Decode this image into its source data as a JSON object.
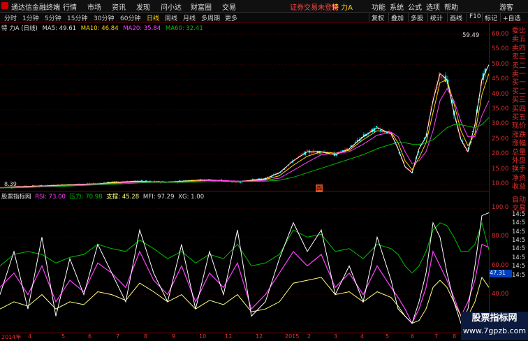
{
  "menu": {
    "app_title": "通达信金融终端",
    "items": [
      "行情",
      "市场",
      "资讯",
      "发现",
      "问小达",
      "财富圈",
      "交易"
    ],
    "status": "证券交易未登录",
    "stock": "特 力A",
    "right_items": [
      "功能",
      "系统",
      "公式",
      "选项",
      "帮助"
    ],
    "guest": "游客"
  },
  "period_bar": {
    "periods": [
      "分时",
      "1分钟",
      "5分钟",
      "15分钟",
      "30分钟",
      "60分钟",
      "日线",
      "周线",
      "月线",
      "多周期",
      "更多"
    ],
    "active": "日线",
    "tools": [
      "复权",
      "叠加",
      "多股",
      "统计",
      "画线",
      "F10",
      "标记",
      "+自选"
    ]
  },
  "main_legend": {
    "title": "特 力A (日线)",
    "ma5": "MA5: 49.61",
    "ma10": "MA10: 46.84",
    "ma20": "MA20: 35.84",
    "ma60": "MA60: 32.41",
    "high_label": "59.49",
    "low_label": "8.39",
    "event_mark": "四"
  },
  "lower_legend": {
    "title": "股票指标网",
    "rsi": "RSI: 73.00",
    "pressure": "压力: 70.98",
    "support": "支撑: 45.28",
    "mfi": "MFI: 97.29",
    "xg": "XG: 1.00",
    "current_value": "47.31"
  },
  "axis": {
    "price_ticks": [
      "60.00",
      "55.00",
      "50.00",
      "45.00",
      "40.00",
      "35.00",
      "30.00",
      "25.00",
      "20.00",
      "15.00",
      "10.00"
    ],
    "ind_ticks": [
      "100.0",
      "80.00",
      "60.00",
      "40.00",
      "20.00"
    ]
  },
  "side_panel": {
    "top": [
      "委比",
      "卖五",
      "卖四",
      "卖三",
      "卖二",
      "卖一",
      "买一",
      "买二",
      "买三",
      "买四",
      "买五",
      "现价",
      "涨跌",
      "涨幅",
      "总量",
      "外盘",
      "换手",
      "净资",
      "收益"
    ],
    "bottom": [
      "自动",
      "交易",
      "14:5",
      "14:5",
      "14:5",
      "14:5",
      "14:5",
      "14:5",
      "14:5",
      "14:5"
    ]
  },
  "dates": [
    "2014年",
    "4",
    "5",
    "6",
    "7",
    "8",
    "9",
    "10",
    "11",
    "12",
    "2015",
    "2",
    "3",
    "4",
    "5",
    "6",
    "7",
    "8",
    "9",
    "10"
  ],
  "watermark": {
    "line1": "股票指标网",
    "line2": "www.7gpzb.com"
  },
  "colors": {
    "ma5": "#ffffff",
    "ma10": "#ffd700",
    "ma20": "#ff40ff",
    "ma60": "#00c000",
    "up": "#ff3030",
    "down": "#00ffff",
    "axis": "#e03030",
    "rsi": "#ff40ff",
    "pressure": "#00c000",
    "support": "#ffff80",
    "mfi": "#ffffff"
  },
  "chart_data": [
    {
      "type": "line",
      "title": "特 力A (日线)",
      "x": [
        0,
        20,
        40,
        60,
        80,
        100,
        120,
        140,
        160,
        180,
        200,
        220,
        240,
        260,
        280,
        300,
        320,
        340,
        360,
        380,
        400,
        420,
        440,
        460,
        480,
        500,
        520,
        540,
        560,
        570,
        580,
        590,
        600,
        610,
        620,
        630,
        640,
        650,
        660,
        670,
        680,
        690,
        700
      ],
      "series": [
        {
          "name": "MA5",
          "values": [
            9,
            9.3,
            9.5,
            9.6,
            9.8,
            10,
            10.2,
            10.3,
            10.8,
            11,
            11.2,
            11,
            10.9,
            11.2,
            11.5,
            11.6,
            11.3,
            11,
            11.5,
            12,
            14,
            18,
            21,
            21,
            20,
            22,
            26,
            29,
            27,
            22,
            16,
            14,
            22,
            26,
            38,
            47,
            45,
            34,
            25,
            21,
            30,
            45,
            50
          ]
        },
        {
          "name": "MA10",
          "values": [
            9,
            9.2,
            9.4,
            9.6,
            9.7,
            9.9,
            10.1,
            10.3,
            10.6,
            10.9,
            11.1,
            11,
            10.9,
            11.1,
            11.4,
            11.5,
            11.4,
            11.1,
            11.3,
            11.8,
            13,
            16.5,
            19.5,
            21,
            20.5,
            21.5,
            25,
            28,
            27.5,
            24,
            18,
            15,
            19,
            24,
            34,
            44,
            45,
            37,
            28,
            23,
            27,
            40,
            47
          ]
        },
        {
          "name": "MA20",
          "values": [
            9,
            9.1,
            9.3,
            9.5,
            9.6,
            9.8,
            10,
            10.2,
            10.4,
            10.7,
            10.9,
            11,
            10.9,
            11,
            11.2,
            11.4,
            11.4,
            11.2,
            11.2,
            11.5,
            12.2,
            14.8,
            17.5,
            20,
            20.5,
            21,
            23.5,
            26.5,
            27.5,
            26,
            21,
            17,
            18,
            21,
            28,
            38,
            42,
            38,
            31,
            26,
            26,
            33,
            38
          ]
        },
        {
          "name": "MA60",
          "values": [
            9,
            9,
            9.1,
            9.3,
            9.4,
            9.6,
            9.8,
            10,
            10.2,
            10.4,
            10.6,
            10.8,
            10.8,
            10.8,
            10.9,
            11,
            11.1,
            11.1,
            11.1,
            11.2,
            11.5,
            12.5,
            14,
            15.5,
            17,
            18.5,
            20,
            22,
            23.5,
            24,
            24,
            23.5,
            23.5,
            24,
            25,
            27,
            29,
            30,
            30,
            29.5,
            29,
            30,
            32.4
          ]
        }
      ],
      "ylim": [
        8,
        62
      ]
    },
    {
      "type": "line",
      "title": "股票指标网",
      "x": [
        0,
        20,
        40,
        60,
        80,
        100,
        120,
        140,
        160,
        180,
        200,
        220,
        240,
        260,
        280,
        300,
        320,
        340,
        360,
        380,
        400,
        420,
        440,
        460,
        480,
        500,
        520,
        540,
        560,
        570,
        580,
        590,
        600,
        610,
        620,
        630,
        640,
        650,
        660,
        670,
        680,
        690,
        700
      ],
      "series": [
        {
          "name": "RSI",
          "values": [
            45,
            55,
            40,
            60,
            35,
            50,
            42,
            62,
            55,
            45,
            70,
            50,
            40,
            60,
            35,
            55,
            45,
            62,
            30,
            40,
            55,
            70,
            60,
            68,
            45,
            55,
            40,
            60,
            45,
            38,
            30,
            20,
            30,
            45,
            70,
            60,
            50,
            38,
            25,
            35,
            50,
            75,
            73
          ]
        },
        {
          "name": "压力",
          "values": [
            60,
            68,
            70,
            68,
            62,
            66,
            68,
            75,
            72,
            70,
            78,
            72,
            65,
            70,
            62,
            68,
            65,
            75,
            60,
            62,
            68,
            85,
            80,
            82,
            70,
            72,
            65,
            75,
            72,
            68,
            60,
            55,
            60,
            70,
            85,
            90,
            88,
            80,
            70,
            70,
            75,
            90,
            71
          ]
        },
        {
          "name": "支撑",
          "values": [
            30,
            35,
            32,
            40,
            30,
            35,
            33,
            42,
            40,
            36,
            48,
            42,
            35,
            40,
            30,
            36,
            33,
            40,
            28,
            30,
            35,
            48,
            50,
            52,
            40,
            42,
            35,
            42,
            38,
            32,
            25,
            20,
            22,
            30,
            45,
            50,
            45,
            35,
            25,
            25,
            35,
            52,
            45
          ]
        },
        {
          "name": "MFI",
          "values": [
            40,
            70,
            30,
            80,
            25,
            65,
            40,
            75,
            55,
            35,
            85,
            55,
            35,
            75,
            30,
            70,
            40,
            85,
            25,
            35,
            65,
            90,
            70,
            85,
            40,
            60,
            35,
            80,
            50,
            30,
            25,
            20,
            35,
            55,
            90,
            80,
            55,
            35,
            20,
            30,
            60,
            95,
            97
          ]
        }
      ],
      "ylim": [
        15,
        105
      ]
    }
  ]
}
